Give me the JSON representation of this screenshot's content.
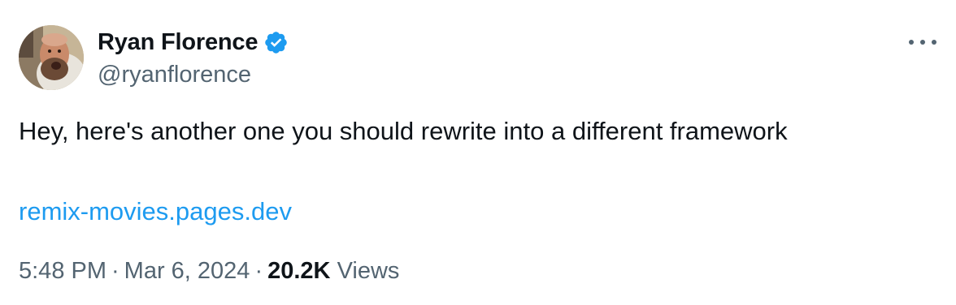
{
  "author": {
    "display_name": "Ryan Florence",
    "handle": "@ryanflorence",
    "verified": true,
    "avatar_icon": "profile-photo"
  },
  "tweet": {
    "text": "Hey, here's another one you should rewrite into a different framework",
    "link": "remix-movies.pages.dev"
  },
  "meta": {
    "time": "5:48 PM",
    "separator": "·",
    "date": "Mar 6, 2024",
    "views_count": "20.2K",
    "views_label": "Views"
  },
  "actions": {
    "more_icon": "more-horizontal-icon"
  },
  "colors": {
    "text": "#0f1419",
    "secondary": "#536471",
    "link": "#1d9bf0",
    "verified_badge": "#1d9bf0"
  }
}
